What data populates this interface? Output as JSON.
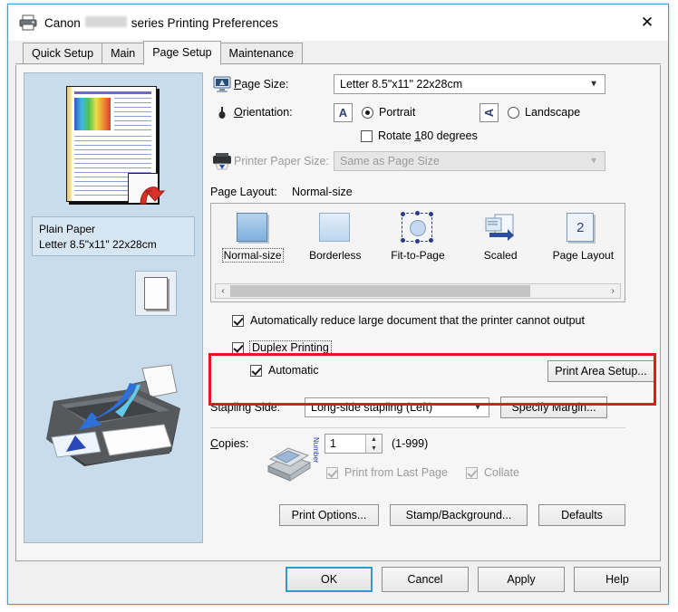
{
  "window": {
    "title_prefix": "Canon",
    "title_suffix": "series Printing Preferences",
    "close_label": "✕",
    "printer_icon": "printer-icon"
  },
  "tabs": [
    {
      "label": "Quick Setup",
      "active": false
    },
    {
      "label": "Main",
      "active": false
    },
    {
      "label": "Page Setup",
      "active": true
    },
    {
      "label": "Maintenance",
      "active": false
    }
  ],
  "preview": {
    "paper_type": "Plain Paper",
    "paper_size": "Letter 8.5\"x11\" 22x28cm"
  },
  "settings": {
    "page_size": {
      "label": "Page Size:",
      "value": "Letter 8.5\"x11\" 22x28cm"
    },
    "orientation": {
      "label": "Orientation:",
      "portrait_label": "Portrait",
      "portrait_selected": true,
      "landscape_label": "Landscape",
      "landscape_selected": false,
      "rotate_label": "Rotate 180 degrees",
      "rotate_checked": false,
      "icon_glyph": "A"
    },
    "printer_paper_size": {
      "label": "Printer Paper Size:",
      "value": "Same as Page Size",
      "disabled": true
    },
    "page_layout": {
      "label": "Page Layout:",
      "value": "Normal-size",
      "items": [
        {
          "label": "Normal-size",
          "selected": true
        },
        {
          "label": "Borderless",
          "selected": false
        },
        {
          "label": "Fit-to-Page",
          "selected": false
        },
        {
          "label": "Scaled",
          "selected": false
        },
        {
          "label": "Page Layout",
          "selected": false,
          "badge": "2"
        }
      ],
      "scroll_left": "‹",
      "scroll_right": "›"
    },
    "auto_reduce": {
      "label": "Automatically reduce large document that the printer cannot output",
      "checked": true
    },
    "duplex": {
      "label": "Duplex Printing",
      "checked": true,
      "focused": true
    },
    "automatic": {
      "label": "Automatic",
      "checked": true
    },
    "print_area_setup": "Print Area Setup...",
    "stapling_side": {
      "label": "Stapling Side:",
      "value": "Long-side stapling (Left)"
    },
    "specify_margin": "Specify Margin...",
    "copies": {
      "label": "Copies:",
      "value": "1",
      "range": "(1-999)",
      "vertical_caption": "Number",
      "print_last_page": {
        "label": "Print from Last Page",
        "checked": true,
        "disabled": true
      },
      "collate": {
        "label": "Collate",
        "checked": true,
        "disabled": true
      }
    },
    "print_options": "Print Options...",
    "stamp_background": "Stamp/Background...",
    "defaults": "Defaults"
  },
  "footer": {
    "ok": "OK",
    "cancel": "Cancel",
    "apply": "Apply",
    "help": "Help"
  },
  "colors": {
    "highlight_red": "#e01b1b",
    "accent_blue": "#3399cc",
    "preview_bg": "#c9dcec"
  }
}
